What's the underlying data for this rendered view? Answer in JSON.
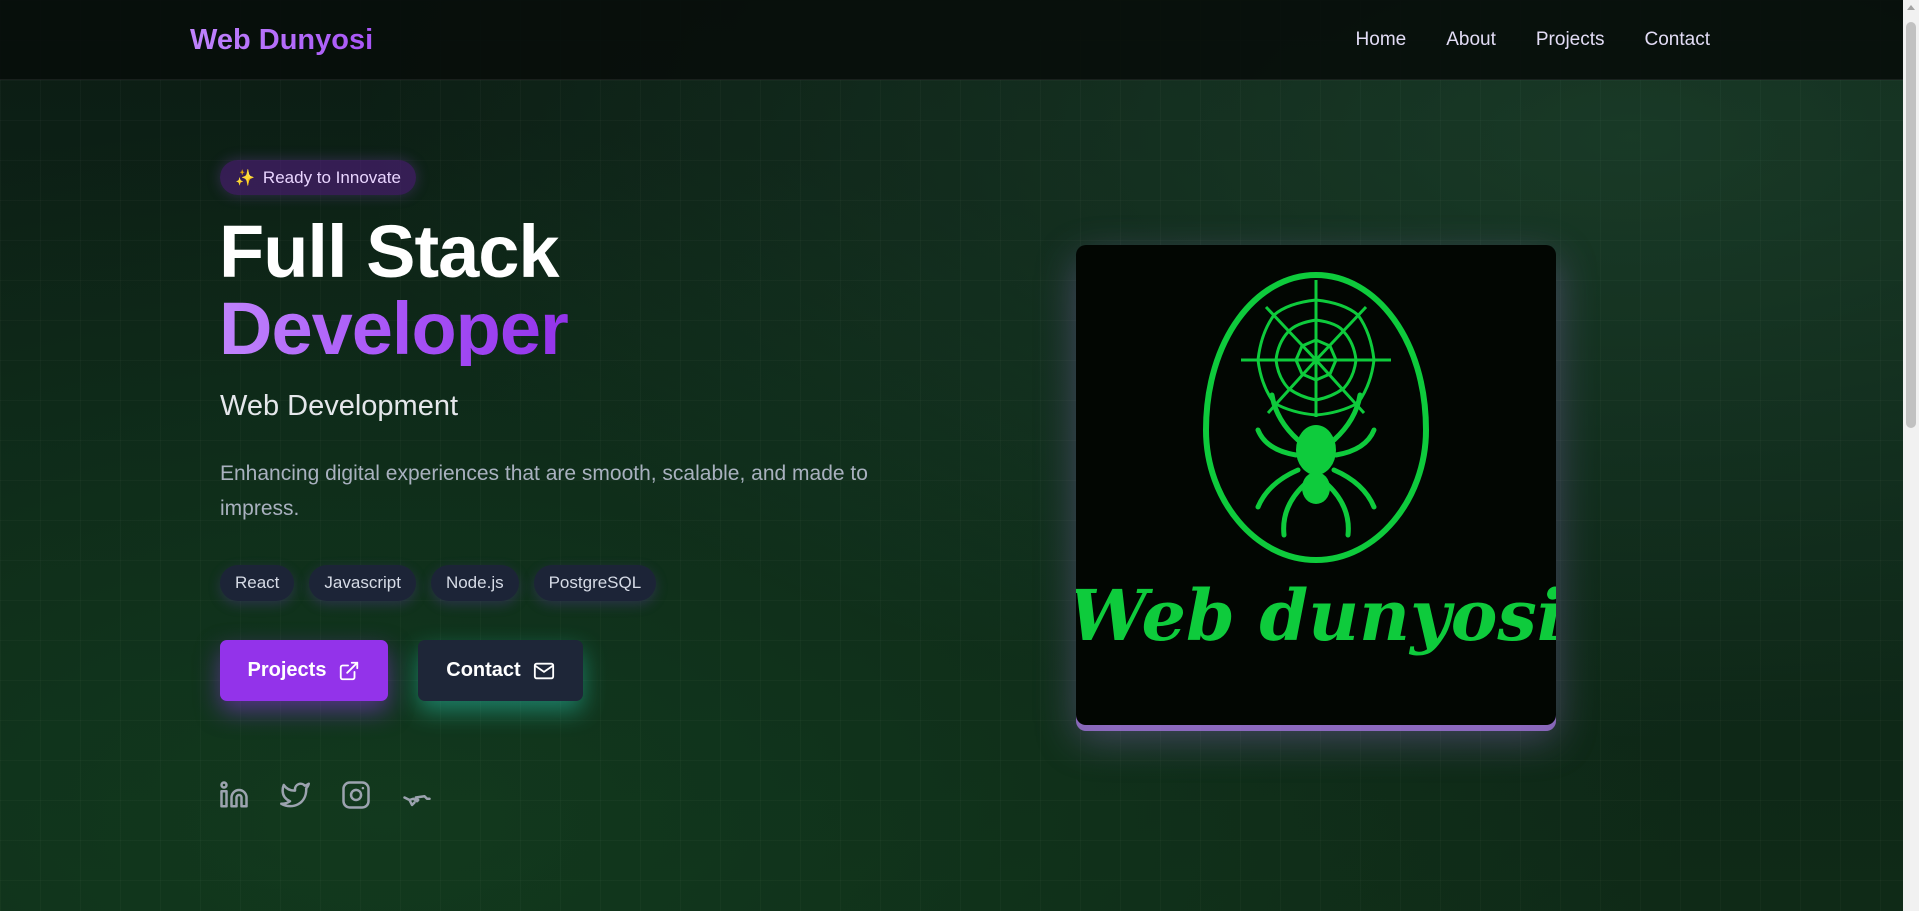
{
  "navbar": {
    "brand": "Web Dunyosi",
    "links": [
      "Home",
      "About",
      "Projects",
      "Contact"
    ]
  },
  "hero": {
    "badge": {
      "icon": "sparkles-icon",
      "glyph": "✨",
      "label": "Ready to Innovate"
    },
    "title_line1": "Full Stack",
    "title_line2": "Developer",
    "subtitle": "Web Development",
    "description": "Enhancing digital experiences that are smooth, scalable, and made to impress.",
    "tags": [
      "React",
      "Javascript",
      "Node.js",
      "PostgreSQL"
    ],
    "buttons": {
      "projects": {
        "label": "Projects",
        "icon": "external-link-icon"
      },
      "contact": {
        "label": "Contact",
        "icon": "mail-icon"
      }
    },
    "socials": [
      "linkedin-icon",
      "twitter-icon",
      "instagram-icon",
      "telegram-icon"
    ]
  },
  "logo": {
    "text": "Web dunyosi",
    "color": "#0ecb3c"
  },
  "colors": {
    "accent": "#a855f7",
    "button_primary": "#9333ea",
    "button_secondary": "#1e2638",
    "logo_green": "#0ecb3c"
  }
}
